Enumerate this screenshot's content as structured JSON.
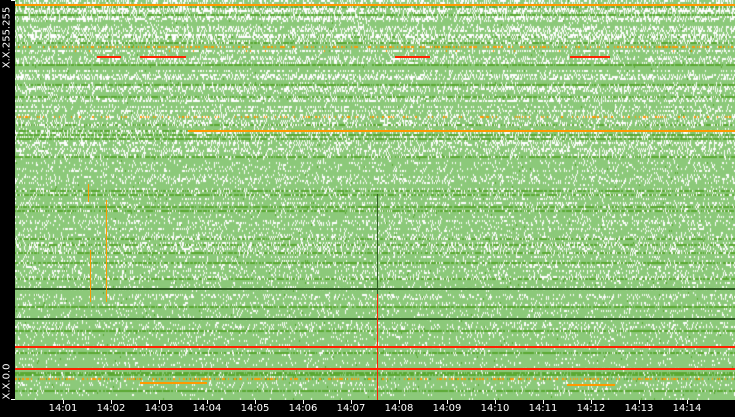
{
  "chart_data": {
    "type": "heatmap",
    "title": "",
    "xlabel": "",
    "ylabel": "",
    "x_unit": "minutes after 14:00",
    "xlim": [
      0,
      15
    ],
    "x_ticks": [
      {
        "t": 1,
        "label": "14:01"
      },
      {
        "t": 2,
        "label": "14:02"
      },
      {
        "t": 3,
        "label": "14:03"
      },
      {
        "t": 4,
        "label": "14:04"
      },
      {
        "t": 5,
        "label": "14:05"
      },
      {
        "t": 6,
        "label": "14:06"
      },
      {
        "t": 7,
        "label": "14:07"
      },
      {
        "t": 8,
        "label": "14:08"
      },
      {
        "t": 9,
        "label": "14:09"
      },
      {
        "t": 10,
        "label": "14:10"
      },
      {
        "t": 11,
        "label": "14:11"
      },
      {
        "t": 12,
        "label": "14:12"
      },
      {
        "t": 13,
        "label": "14:13"
      },
      {
        "t": 14,
        "label": "14:14"
      }
    ],
    "y_rows": 200,
    "y_labels": {
      "top": "X.X.255.255",
      "bottom": "X.X.0.0"
    },
    "colors": {
      "low": "#8cc97a",
      "empty": "#ffffff",
      "medium": "#5aa832",
      "high": "#ff9900",
      "peak": "#ff2200",
      "dark": "#2f5d22"
    },
    "highlights": [
      {
        "kind": "h",
        "row": 197,
        "t0": 0,
        "t1": 15,
        "level": "high"
      },
      {
        "kind": "h",
        "row": 171,
        "t0": 1.71,
        "t1": 2.21,
        "level": "peak"
      },
      {
        "kind": "h",
        "row": 171,
        "t0": 2.6,
        "t1": 3.56,
        "level": "peak"
      },
      {
        "kind": "h",
        "row": 171,
        "t0": 7.92,
        "t1": 8.65,
        "level": "peak"
      },
      {
        "kind": "h",
        "row": 171,
        "t0": 11.56,
        "t1": 12.4,
        "level": "peak"
      },
      {
        "kind": "h",
        "row": 134,
        "t0": 3.6,
        "t1": 15,
        "level": "high"
      },
      {
        "kind": "h",
        "row": 26,
        "t0": 0,
        "t1": 15,
        "level": "peak"
      },
      {
        "kind": "h",
        "row": 15,
        "t0": 0,
        "t1": 15,
        "level": "peak"
      },
      {
        "kind": "h",
        "row": 8,
        "t0": 2.6,
        "t1": 4,
        "level": "high"
      },
      {
        "kind": "h",
        "row": 7,
        "t0": 11.5,
        "t1": 12.5,
        "level": "high"
      },
      {
        "kind": "h",
        "row": 55,
        "t0": 0,
        "t1": 15,
        "level": "dark"
      },
      {
        "kind": "h",
        "row": 40,
        "t0": 0,
        "t1": 15,
        "level": "dark"
      },
      {
        "kind": "v",
        "t": 1.52,
        "r0": 99,
        "r1": 107,
        "level": "high"
      },
      {
        "kind": "v",
        "t": 1.56,
        "r0": 49,
        "r1": 74,
        "level": "high"
      },
      {
        "kind": "v",
        "t": 1.9,
        "r0": 49,
        "r1": 99,
        "level": "high"
      },
      {
        "kind": "v",
        "t": 7.54,
        "r0": 0,
        "r1": 102,
        "level": "dark"
      },
      {
        "kind": "v",
        "t": 7.54,
        "r0": 0,
        "r1": 52,
        "level": "peak"
      }
    ]
  }
}
